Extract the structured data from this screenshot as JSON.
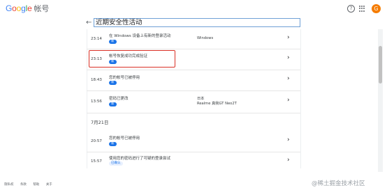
{
  "header": {
    "logo": "Google",
    "account_label": "帐号",
    "help_icon": "question-icon",
    "apps_icon": "grid-icon",
    "avatar_letter": "G"
  },
  "page": {
    "back_icon": "arrow-left-icon",
    "title": "近期安全性活动"
  },
  "events": [
    {
      "time": "23:14",
      "message": "在 Windows 设备上有新的登录活动",
      "badge": "新",
      "device": "Windows",
      "device_model": ""
    },
    {
      "time": "23:13",
      "message": "帐号恢复成功完成验证",
      "badge": "新",
      "device": "",
      "device_model": ""
    },
    {
      "time": "18:43",
      "message": "您的帐号已被停用",
      "badge": "新",
      "device": "",
      "device_model": ""
    },
    {
      "time": "13:56",
      "message": "密码已更改",
      "badge": "新",
      "device": "日本",
      "device_model": "Realme 真我GT Neo2T"
    }
  ],
  "date_header": "7月21日",
  "events_jul21": [
    {
      "time": "20:57",
      "message": "您的帐号已被停用",
      "badge": "新"
    },
    {
      "time": "15:57",
      "message": "使用您的密码进行了可疑的登录尝试",
      "badge": "已确认"
    }
  ],
  "footer": {
    "links": [
      "隐私权",
      "条款",
      "帮助",
      "关于"
    ]
  },
  "watermark": "@稀土掘金技术社区",
  "colors": {
    "accent": "#1a73e8",
    "highlight": "#d93025",
    "avatar": "#f57c00"
  }
}
